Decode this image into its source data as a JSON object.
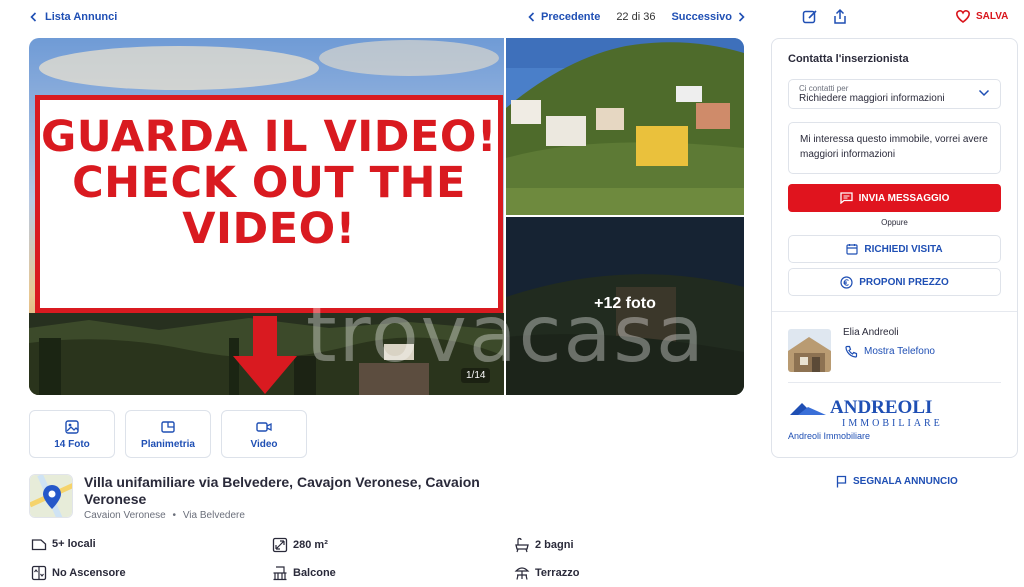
{
  "nav": {
    "back_label": "Lista Annunci",
    "prev_label": "Precedente",
    "count": "22 di 36",
    "next_label": "Successivo",
    "save_label": "SALVA"
  },
  "gallery": {
    "promo_lines": [
      "GUARDA IL VIDEO!",
      "CHECK OUT THE",
      "VIDEO!"
    ],
    "watermark": "trovacasa",
    "photo_counter": "1/14",
    "more_photos": "+12 foto"
  },
  "tabs": [
    {
      "label": "14 Foto",
      "icon": "photo-icon"
    },
    {
      "label": "Planimetria",
      "icon": "floorplan-icon"
    },
    {
      "label": "Video",
      "icon": "video-icon"
    }
  ],
  "listing": {
    "title": "Villa unifamiliare via Belvedere, Cavajon Veronese, Cavaion Veronese",
    "town": "Cavaion Veronese",
    "street": "Via Belvedere",
    "separator": "•"
  },
  "features": [
    {
      "label": "5+ locali",
      "icon": "rooms-icon"
    },
    {
      "label": "280 m²",
      "icon": "area-icon"
    },
    {
      "label": "2 bagni",
      "icon": "bath-icon"
    },
    {
      "label": "No Ascensore",
      "icon": "elevator-icon"
    },
    {
      "label": "Balcone",
      "icon": "balcony-icon"
    },
    {
      "label": "Terrazzo",
      "icon": "terrace-icon"
    }
  ],
  "contact": {
    "title": "Contatta l'inserzionista",
    "select_label": "Ci contatti per",
    "select_value": "Richiedere maggiori informazioni",
    "message": "Mi interessa questo immobile, vorrei avere maggiori informazioni",
    "send_label": "INVIA MESSAGGIO",
    "or_label": "Oppure",
    "visit_label": "RICHIEDI VISITA",
    "offer_label": "PROPONI PREZZO",
    "agent_name": "Elia Andreoli",
    "phone_label": "Mostra Telefono",
    "logo_text_top": "ANDREOLI",
    "logo_text_bottom": "IMMOBILIARE",
    "agency_name": "Andreoli Immobiliare"
  },
  "report_label": "SEGNALA ANNUNCIO",
  "colors": {
    "accent": "#1f4fb4",
    "brand_red": "#e0141e",
    "promo_red": "#d91a20"
  }
}
